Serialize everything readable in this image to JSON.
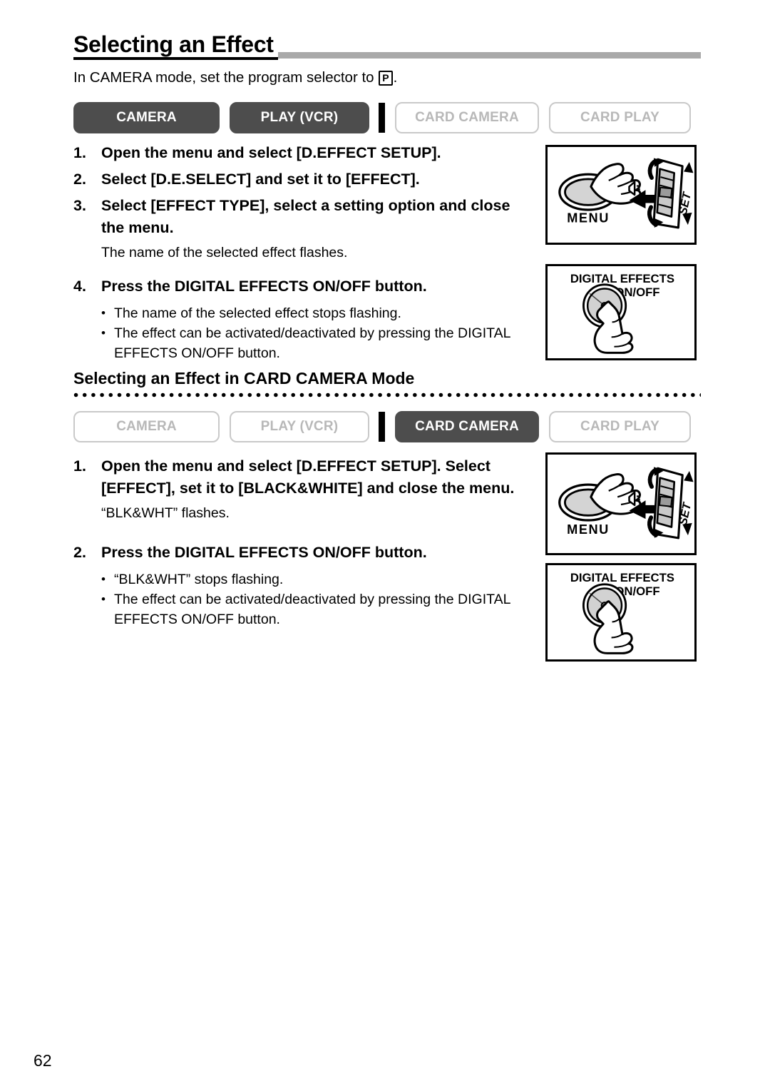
{
  "page": {
    "title": "Selecting an Effect",
    "intro_before": "In CAMERA mode, set the program selector to",
    "intro_icon": "P",
    "intro_after": ".",
    "page_number": "62"
  },
  "mode_bar_1": {
    "buttons": [
      {
        "label": "CAMERA",
        "active": true
      },
      {
        "label": "PLAY (VCR)",
        "active": true
      },
      {
        "label": "CARD CAMERA",
        "active": false
      },
      {
        "label": "CARD PLAY",
        "active": false
      }
    ]
  },
  "mode_bar_2": {
    "buttons": [
      {
        "label": "CAMERA",
        "active": false
      },
      {
        "label": "PLAY (VCR)",
        "active": false
      },
      {
        "label": "CARD CAMERA",
        "active": true
      },
      {
        "label": "CARD PLAY",
        "active": false
      }
    ]
  },
  "section_1": {
    "steps": [
      {
        "num": "1.",
        "text": "Open the menu and select [D.EFFECT SETUP]."
      },
      {
        "num": "2.",
        "text": "Select [D.E.SELECT] and set it to [EFFECT]."
      },
      {
        "num": "3.",
        "text": "Select [EFFECT TYPE], select a setting option and close the menu."
      }
    ],
    "note": "The name of the selected effect flashes.",
    "step4": {
      "num": "4.",
      "text": "Press the DIGITAL EFFECTS ON/OFF button."
    },
    "bullets": [
      "The name of the selected effect stops flashing.",
      "The effect can be activated/deactivated by pressing the DIGITAL EFFECTS ON/OFF button."
    ]
  },
  "section_2": {
    "heading": "Selecting an Effect in CARD CAMERA Mode",
    "step1": {
      "num": "1.",
      "text": "Open the menu and select [D.EFFECT SETUP]. Select [EFFECT], set it to [BLACK&WHITE] and close the menu."
    },
    "note": "“BLK&WHT” flashes.",
    "step2": {
      "num": "2.",
      "text": "Press the DIGITAL EFFECTS ON/OFF button."
    },
    "bullets": [
      "“BLK&WHT” stops flashing.",
      "The effect can be activated/deactivated by pressing the DIGITAL EFFECTS ON/OFF button."
    ]
  },
  "illustrations": {
    "menu_dial": {
      "menu_label": "MENU",
      "set_label": "SET"
    },
    "digital_effects": {
      "line1": "DIGITAL EFFECTS",
      "line2": "ON/OFF"
    }
  },
  "colors": {
    "active_button_bg": "#4d4d4d",
    "inactive_button_border": "#c9c9c9",
    "inactive_button_text": "#b8b8b8",
    "title_rule": "#a9a9a9"
  }
}
